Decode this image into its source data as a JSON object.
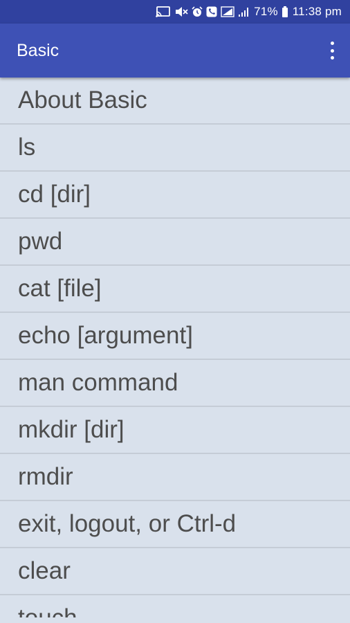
{
  "status_bar": {
    "battery": "71%",
    "time": "11:38 pm",
    "icons": [
      "cast-icon",
      "mute-icon",
      "alarm-icon",
      "call-icon",
      "wifi-icon",
      "signal-icon",
      "battery-icon"
    ]
  },
  "app_bar": {
    "title": "Basic",
    "menu_icon": "more-vert-icon"
  },
  "list": {
    "items": [
      "About Basic",
      "ls",
      "cd [dir]",
      "pwd",
      "cat [file]",
      "echo [argument]",
      "man command",
      "mkdir [dir]",
      "rmdir",
      "exit, logout, or Ctrl-d",
      "clear",
      "touch"
    ]
  }
}
